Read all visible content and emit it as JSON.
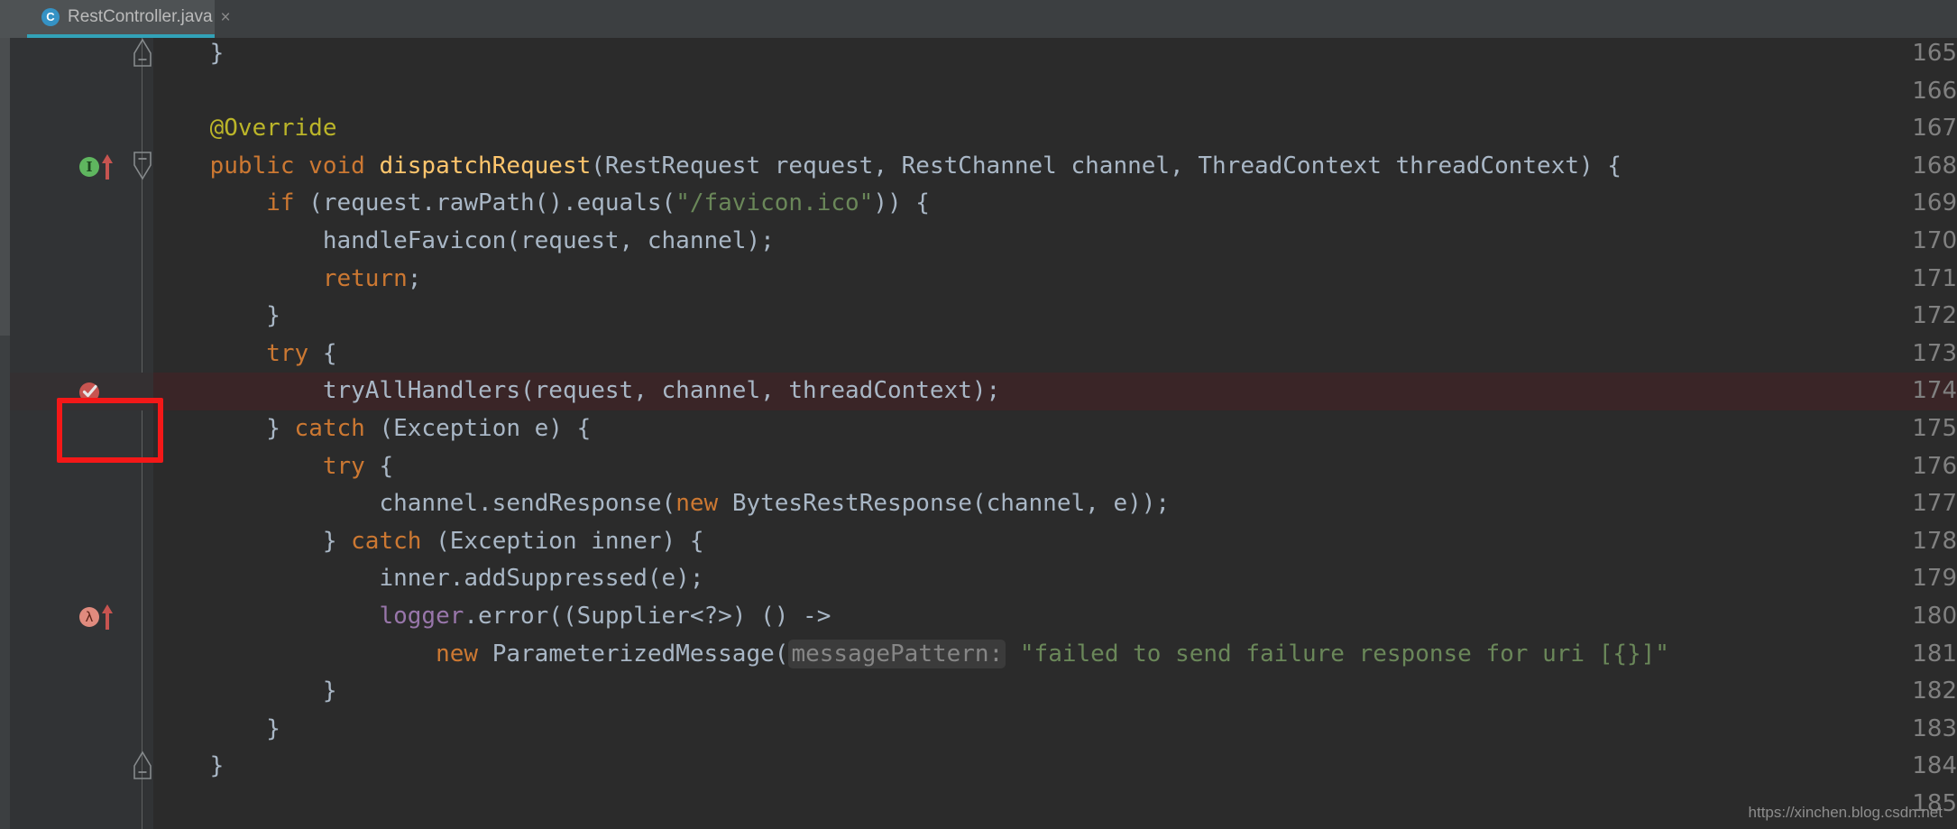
{
  "window": {
    "background": "#2b2b2b",
    "theme": "darcula"
  },
  "tabbar": {
    "active_tab": {
      "filename": "RestController.java",
      "icon": "java-class-icon",
      "icon_letter": "C",
      "close_label": "×",
      "underline_color": "#32a2b8"
    }
  },
  "editor": {
    "language": "java",
    "first_visible_line": 165,
    "last_visible_line": 185,
    "highlighted_line": 174,
    "colors": {
      "background": "#2b2b2b",
      "gutter": "#313335",
      "keyword": "#cc7832",
      "method": "#ffc66d",
      "string": "#6a8759",
      "annotation": "#bbb529",
      "static_field": "#9876aa",
      "plain": "#a9b7c6",
      "line_number": "#808080",
      "breakpoint_line_bg": "#3a2527",
      "param_hint": "#868686"
    },
    "lines": [
      {
        "number": "165",
        "segments": [
          {
            "t": "plain",
            "v": "    }"
          }
        ],
        "fold": "end",
        "markers": []
      },
      {
        "number": "166",
        "segments": [],
        "fold": "none",
        "markers": []
      },
      {
        "number": "167",
        "segments": [
          {
            "t": "annotation",
            "v": "    @Override"
          }
        ],
        "fold": "none",
        "markers": []
      },
      {
        "number": "168",
        "segments": [
          {
            "t": "keyword",
            "v": "    public void "
          },
          {
            "t": "method",
            "v": "dispatchRequest"
          },
          {
            "t": "plain",
            "v": "(RestRequest request, RestChannel channel, ThreadContext threadContext) {"
          }
        ],
        "fold": "start",
        "markers": [
          "implements-method-icon",
          "overrides-method-arrow-icon"
        ]
      },
      {
        "number": "169",
        "segments": [
          {
            "t": "keyword",
            "v": "        if "
          },
          {
            "t": "plain",
            "v": "(request.rawPath().equals("
          },
          {
            "t": "string",
            "v": "\"/favicon.ico\""
          },
          {
            "t": "plain",
            "v": ")) {"
          }
        ],
        "fold": "none",
        "markers": []
      },
      {
        "number": "170",
        "segments": [
          {
            "t": "plain",
            "v": "            handleFavicon(request, channel);"
          }
        ],
        "fold": "none",
        "markers": []
      },
      {
        "number": "171",
        "segments": [
          {
            "t": "keyword",
            "v": "            return"
          },
          {
            "t": "plain",
            "v": ";"
          }
        ],
        "fold": "none",
        "markers": []
      },
      {
        "number": "172",
        "segments": [
          {
            "t": "plain",
            "v": "        }"
          }
        ],
        "fold": "none",
        "markers": []
      },
      {
        "number": "173",
        "segments": [
          {
            "t": "keyword",
            "v": "        try "
          },
          {
            "t": "plain",
            "v": "{"
          }
        ],
        "fold": "none",
        "markers": []
      },
      {
        "number": "174",
        "segments": [
          {
            "t": "plain",
            "v": "            tryAllHandlers(request, channel, threadContext);"
          }
        ],
        "fold": "none",
        "markers": [
          "breakpoint-icon"
        ],
        "highlighted": true
      },
      {
        "number": "175",
        "segments": [
          {
            "t": "plain",
            "v": "        } "
          },
          {
            "t": "keyword",
            "v": "catch "
          },
          {
            "t": "plain",
            "v": "(Exception e) {"
          }
        ],
        "fold": "none",
        "markers": []
      },
      {
        "number": "176",
        "segments": [
          {
            "t": "keyword",
            "v": "            try "
          },
          {
            "t": "plain",
            "v": "{"
          }
        ],
        "fold": "none",
        "markers": []
      },
      {
        "number": "177",
        "segments": [
          {
            "t": "plain",
            "v": "                channel.sendResponse("
          },
          {
            "t": "keyword",
            "v": "new "
          },
          {
            "t": "plain",
            "v": "BytesRestResponse(channel, e));"
          }
        ],
        "fold": "none",
        "markers": []
      },
      {
        "number": "178",
        "segments": [
          {
            "t": "plain",
            "v": "            } "
          },
          {
            "t": "keyword",
            "v": "catch "
          },
          {
            "t": "plain",
            "v": "(Exception inner) {"
          }
        ],
        "fold": "none",
        "markers": []
      },
      {
        "number": "179",
        "segments": [
          {
            "t": "plain",
            "v": "                inner.addSuppressed(e);"
          }
        ],
        "fold": "none",
        "markers": []
      },
      {
        "number": "180",
        "segments": [
          {
            "t": "plain",
            "v": "                "
          },
          {
            "t": "static_field",
            "v": "logger"
          },
          {
            "t": "plain",
            "v": ".error((Supplier<?>) () ->"
          }
        ],
        "fold": "none",
        "markers": [
          "lambda-icon",
          "overrides-method-arrow-icon"
        ]
      },
      {
        "number": "181",
        "segments": [
          {
            "t": "plain",
            "v": "                    "
          },
          {
            "t": "keyword",
            "v": "new "
          },
          {
            "t": "plain",
            "v": "ParameterizedMessage("
          },
          {
            "t": "hint",
            "v": "messagePattern:"
          },
          {
            "t": "string",
            "v": " \"failed to send failure response for uri [{}]\""
          }
        ],
        "fold": "none",
        "markers": []
      },
      {
        "number": "182",
        "segments": [
          {
            "t": "plain",
            "v": "            }"
          }
        ],
        "fold": "none",
        "markers": []
      },
      {
        "number": "183",
        "segments": [
          {
            "t": "plain",
            "v": "        }"
          }
        ],
        "fold": "none",
        "markers": []
      },
      {
        "number": "184",
        "segments": [
          {
            "t": "plain",
            "v": "    }"
          }
        ],
        "fold": "end",
        "markers": []
      },
      {
        "number": "185",
        "segments": [],
        "fold": "none",
        "markers": []
      }
    ]
  },
  "annotation": {
    "type": "red-rectangle-highlight",
    "target_line": "174",
    "color": "#f41818"
  },
  "watermark": {
    "text": "https://xinchen.blog.csdn.net"
  }
}
